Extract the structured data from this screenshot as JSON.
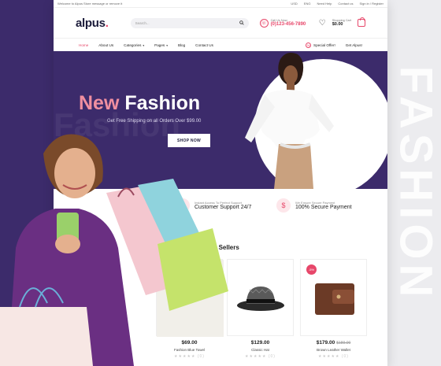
{
  "showcase": {
    "vertical_word": "FASHION"
  },
  "topbar": {
    "welcome": "Welcome to Alpus Store message or remove it",
    "links": [
      "USD",
      "ENG",
      "Need Help",
      "Contact us",
      "Sign in / Register"
    ]
  },
  "header": {
    "logo": "alpus",
    "logo_dot": ".",
    "search_placeholder": "Search...",
    "call_label": "Call Us Now:",
    "call_number": "(0)123-456-7890",
    "cart_label": "Shopping Cart",
    "cart_amount": "$0.00"
  },
  "nav": {
    "items": [
      {
        "label": "Home",
        "active": true
      },
      {
        "label": "About Us"
      },
      {
        "label": "Categories",
        "dropdown": true
      },
      {
        "label": "Pages",
        "dropdown": true
      },
      {
        "label": "Blog"
      },
      {
        "label": "Contact Us"
      }
    ],
    "special_offer": "Special Offer!",
    "get_alpus": "Get Alpus!"
  },
  "hero": {
    "title_new": "New",
    "title_main": "Fashion",
    "subtitle": "Get Free Shipping on all Orders Over $99.00",
    "button": "SHOP NOW",
    "ghost": "Fashion"
  },
  "features": [
    {
      "small": "Instant Access To Perfect Support",
      "big": "Customer Support 24/7",
      "icon": "headset-icon"
    },
    {
      "small": "We Ensure Secure Payment",
      "big": "100% Secure Payment",
      "icon": "dollar-icon"
    }
  ],
  "products": {
    "section_title": "Best Sellers",
    "items": [
      {
        "name": "Fashion Blue Towel",
        "price": "$69.00",
        "old_price": "",
        "badge": ""
      },
      {
        "name": "Classic Hat",
        "price": "$129.00",
        "old_price": "",
        "badge": ""
      },
      {
        "name": "Brown Leather Wallet",
        "price": "$179.00",
        "old_price": "$189.00",
        "badge": "-5%"
      }
    ],
    "rating_count": "(0)"
  },
  "colors": {
    "accent": "#e7476a",
    "hero_bg": "#3c2b6b",
    "showcase_bg": "#3c2b6b"
  }
}
